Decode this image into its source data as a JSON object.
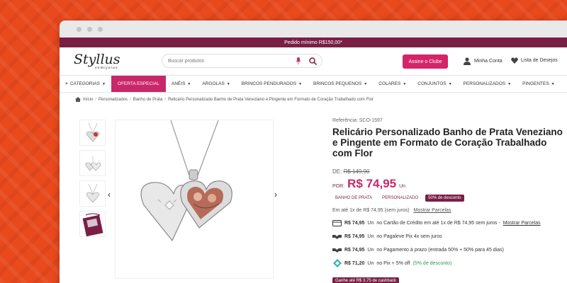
{
  "topbar": {
    "text": "Pedido mínimo R$150,00*"
  },
  "header": {
    "logo": "Styllus",
    "logo_sub": "semijoias",
    "search_placeholder": "Buscar produtos",
    "club_button": "Assine o Clube",
    "account": "Minha Conta",
    "wishlist": "Lista de Desejos"
  },
  "nav": {
    "items": [
      {
        "label": "CATEGORIAS"
      },
      {
        "label": "OFERTA ESPECIAL"
      },
      {
        "label": "ANÉIS"
      },
      {
        "label": "ARGOLAS"
      },
      {
        "label": "BRINCOS PENDURADOS"
      },
      {
        "label": "BRINCOS PEQUENOS"
      },
      {
        "label": "COLARES"
      },
      {
        "label": "CONJUNTOS"
      },
      {
        "label": "PERSONALIZADOS"
      },
      {
        "label": "PINGENTES"
      }
    ]
  },
  "breadcrumb": [
    "Início",
    "Personalizados",
    "Banho de Prata",
    "Relicário Personalizado Banho de Prata Veneziano e Pingente em Formato de Coração Trabalhado com Flor"
  ],
  "product": {
    "reference": "Referência: SCO-1597",
    "title_lines": [
      "Relicário Personalizado Banho de Prata Veneziano",
      "e Pingente em Formato de Coração Trabalhado",
      "com Flor"
    ],
    "old_label": "DE:",
    "old_price": "R$ 149,90",
    "por_label": "POR:",
    "price": "R$ 74,95",
    "unit": "Un",
    "tags": [
      "BANHO DE PRATA",
      "PERSONALIZADO"
    ],
    "discount": "50% de desconto",
    "installment": "Em até 1x de R$ 74,95 (sem juros)",
    "installment_link": "Mostrar Parcelas",
    "payments": [
      {
        "icon": "credit-card-icon",
        "amount": "R$ 74,95",
        "unit": "Un",
        "text": "no Cartão de Crédito em até 1x de R$ 74,95 sem juros -",
        "link": "Mostrar Parcelas"
      },
      {
        "icon": "handshake-icon",
        "amount": "R$ 74,95",
        "unit": "Un",
        "text": "no Pagaleve Pix 4x sem juros",
        "link": ""
      },
      {
        "icon": "handshake-icon",
        "amount": "R$ 74,95",
        "unit": "Un",
        "text": "no Pagamento à prazo (entrada 50% + 50% para 45 dias)",
        "link": ""
      },
      {
        "icon": "pix-icon",
        "amount": "R$ 71,20",
        "unit": "Un",
        "text": "no Pix + 5% off",
        "green": "(5% de desconto)"
      }
    ],
    "cashback": "Ganhe até R$ 3,75 de cashback"
  },
  "colors": {
    "brand": "#7a1f44",
    "accent": "#c8286a",
    "background": "#e8491d"
  }
}
